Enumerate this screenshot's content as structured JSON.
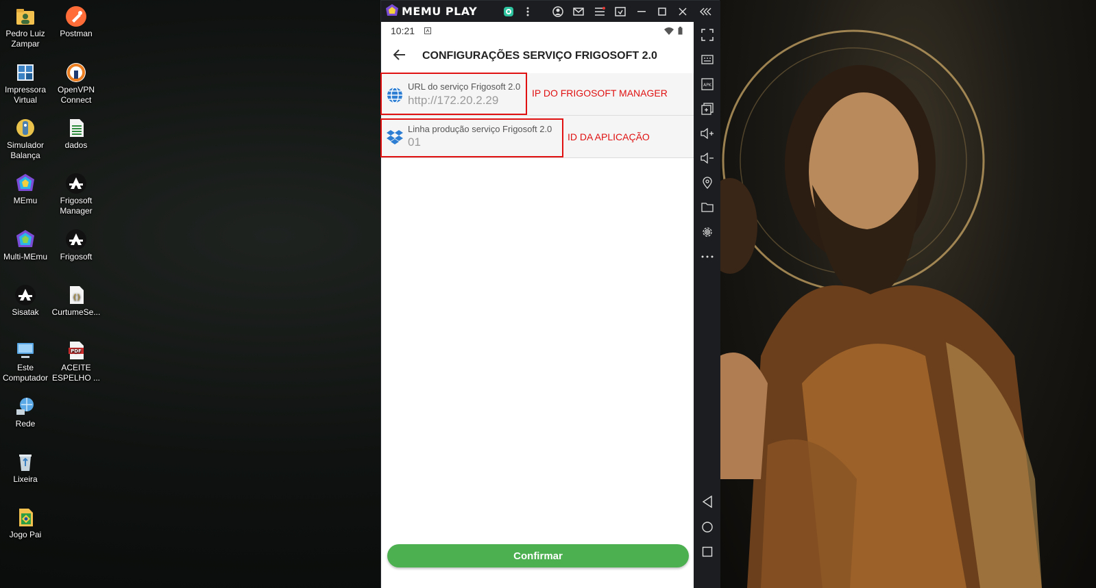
{
  "desktop": {
    "icons": [
      {
        "label": "Pedro Luiz Zampar",
        "icon": "folder-user-icon",
        "color": "#f2c14e"
      },
      {
        "label": "Postman",
        "icon": "postman-icon",
        "color": "#ff6c37"
      },
      {
        "label": "Impressora Virtual",
        "icon": "printer-icon",
        "color": "#3b82c4"
      },
      {
        "label": "OpenVPN Connect",
        "icon": "openvpn-icon",
        "color": "#ea7e20"
      },
      {
        "label": "Simulador Balança",
        "icon": "scale-icon",
        "color": "#e8c24a"
      },
      {
        "label": "dados",
        "icon": "spreadsheet-icon",
        "color": "#2e8b3d"
      },
      {
        "label": "MEmu",
        "icon": "memu-icon",
        "color": "#7b4dd6"
      },
      {
        "label": "Frigosoft Manager",
        "icon": "frigosoft-manager-icon",
        "color": "#ffffff"
      },
      {
        "label": "Multi-MEmu",
        "icon": "multi-memu-icon",
        "color": "#7b4dd6"
      },
      {
        "label": "Frigosoft",
        "icon": "frigosoft-icon",
        "color": "#ffffff"
      },
      {
        "label": "Sisatak",
        "icon": "sisatak-icon",
        "color": "#ffffff"
      },
      {
        "label": "CurtumeSe...",
        "icon": "json-file-icon",
        "color": "#e0b94a"
      },
      {
        "label": "Este Computador",
        "icon": "computer-icon",
        "color": "#5aa9e6"
      },
      {
        "label": "ACEITE ESPELHO ...",
        "icon": "pdf-icon",
        "color": "#d32f2f"
      },
      {
        "label": "Rede",
        "icon": "network-icon",
        "color": "#5aa9e6"
      },
      {
        "label": "Lixeira",
        "icon": "recycle-bin-icon",
        "color": "#c8d4dd"
      },
      {
        "label": "Jogo Pai",
        "icon": "game-file-icon",
        "color": "#2e9e45"
      }
    ]
  },
  "emulator": {
    "brand": "MEMU PLAY",
    "status_time": "10:21",
    "app_title": "CONFIGURAÇÕES SERVIÇO FRIGOSOFT 2.0",
    "settings": [
      {
        "label": "URL do serviço Frigosoft 2.0",
        "value": "http://172.20.2.29",
        "icon": "globe-icon",
        "annotation": "IP DO FRIGOSOFT MANAGER"
      },
      {
        "label": "Linha produção serviço Frigosoft 2.0",
        "value": "01",
        "icon": "dropbox-icon",
        "annotation": "ID DA APLICAÇÃO"
      }
    ],
    "confirm_label": "Confirmar",
    "accent_color": "#4caf50",
    "annotation_color": "#e01010"
  }
}
